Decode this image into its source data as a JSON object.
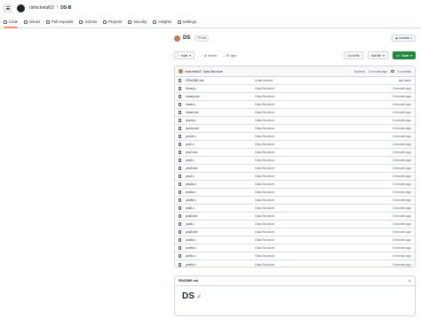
{
  "header": {
    "owner": "rishichelal02",
    "separator": "/",
    "repo": "DS-B"
  },
  "tabs": [
    {
      "label": "Code",
      "icon": "code-icon"
    },
    {
      "label": "Issues",
      "icon": "issue-icon"
    },
    {
      "label": "Pull requests",
      "icon": "pull-request-icon"
    },
    {
      "label": "Actions",
      "icon": "play-icon"
    },
    {
      "label": "Projects",
      "icon": "table-icon"
    },
    {
      "label": "Security",
      "icon": "shield-icon"
    },
    {
      "label": "Insights",
      "icon": "graph-icon"
    },
    {
      "label": "Settings",
      "icon": "gear-icon"
    }
  ],
  "repo": {
    "name": "DS",
    "visibility": "Private",
    "watch_label": "Unwatch",
    "watch_count": "1"
  },
  "toolbar": {
    "branch": "main",
    "branches_count": "1",
    "branches_label": "branch",
    "tags_count": "0",
    "tags_label": "tags",
    "goto_label": "Go to file",
    "add_label": "Add file",
    "code_label": "Code"
  },
  "commit": {
    "author": "rishichelal02",
    "message": "Data Structure",
    "hash": "1fa4eea",
    "time": "3 minutes ago",
    "count_label": "2 commits"
  },
  "files": [
    {
      "name": "README.md",
      "msg": "Initial commit",
      "age": "last week"
    },
    {
      "name": "binary.c",
      "msg": "Data Structure",
      "age": "3 minutes ago"
    },
    {
      "name": "binary.exe",
      "msg": "Data Structure",
      "age": "3 minutes ago"
    },
    {
      "name": "linear.c",
      "msg": "Data Structure",
      "age": "3 minutes ago"
    },
    {
      "name": "linear.exe",
      "msg": "Data Structure",
      "age": "3 minutes ago"
    },
    {
      "name": "pra1a.c",
      "msg": "Data Structure",
      "age": "3 minutes ago"
    },
    {
      "name": "pra1a.exe",
      "msg": "Data Structure",
      "age": "3 minutes ago"
    },
    {
      "name": "pra1b.c",
      "msg": "Data Structure",
      "age": "3 minutes ago"
    },
    {
      "name": "pra2.c",
      "msg": "Data Structure",
      "age": "3 minutes ago"
    },
    {
      "name": "pra2.exe",
      "msg": "Data Structure",
      "age": "3 minutes ago"
    },
    {
      "name": "pra3.c",
      "msg": "Data Structure",
      "age": "3 minutes ago"
    },
    {
      "name": "pra3.exe",
      "msg": "Data Structure",
      "age": "3 minutes ago"
    },
    {
      "name": "pra4.c",
      "msg": "Data Structure",
      "age": "3 minutes ago"
    },
    {
      "name": "pra4b.c",
      "msg": "Data Structure",
      "age": "3 minutes ago"
    },
    {
      "name": "pra5a.c",
      "msg": "Data Structure",
      "age": "3 minutes ago"
    },
    {
      "name": "pra5b.c",
      "msg": "Data Structure",
      "age": "3 minutes ago"
    },
    {
      "name": "pra6.c",
      "msg": "Data Structure",
      "age": "3 minutes ago"
    },
    {
      "name": "pra6.exe",
      "msg": "Data Structure",
      "age": "3 minutes ago"
    },
    {
      "name": "pra8.c",
      "msg": "Data Structure",
      "age": "3 minutes ago"
    },
    {
      "name": "pra8.exe",
      "msg": "Data Structure",
      "age": "3 minutes ago"
    },
    {
      "name": "pra8b.c",
      "msg": "Data Structure",
      "age": "3 minutes ago"
    },
    {
      "name": "pra9b.c",
      "msg": "Data Structure",
      "age": "3 minutes ago"
    },
    {
      "name": "pra9c.c",
      "msg": "Data Structure",
      "age": "3 minutes ago"
    },
    {
      "name": "pra9d.c",
      "msg": "Data Structure",
      "age": "3 minutes ago"
    }
  ],
  "readme": {
    "file_label": "README.md",
    "heading": "DS"
  }
}
